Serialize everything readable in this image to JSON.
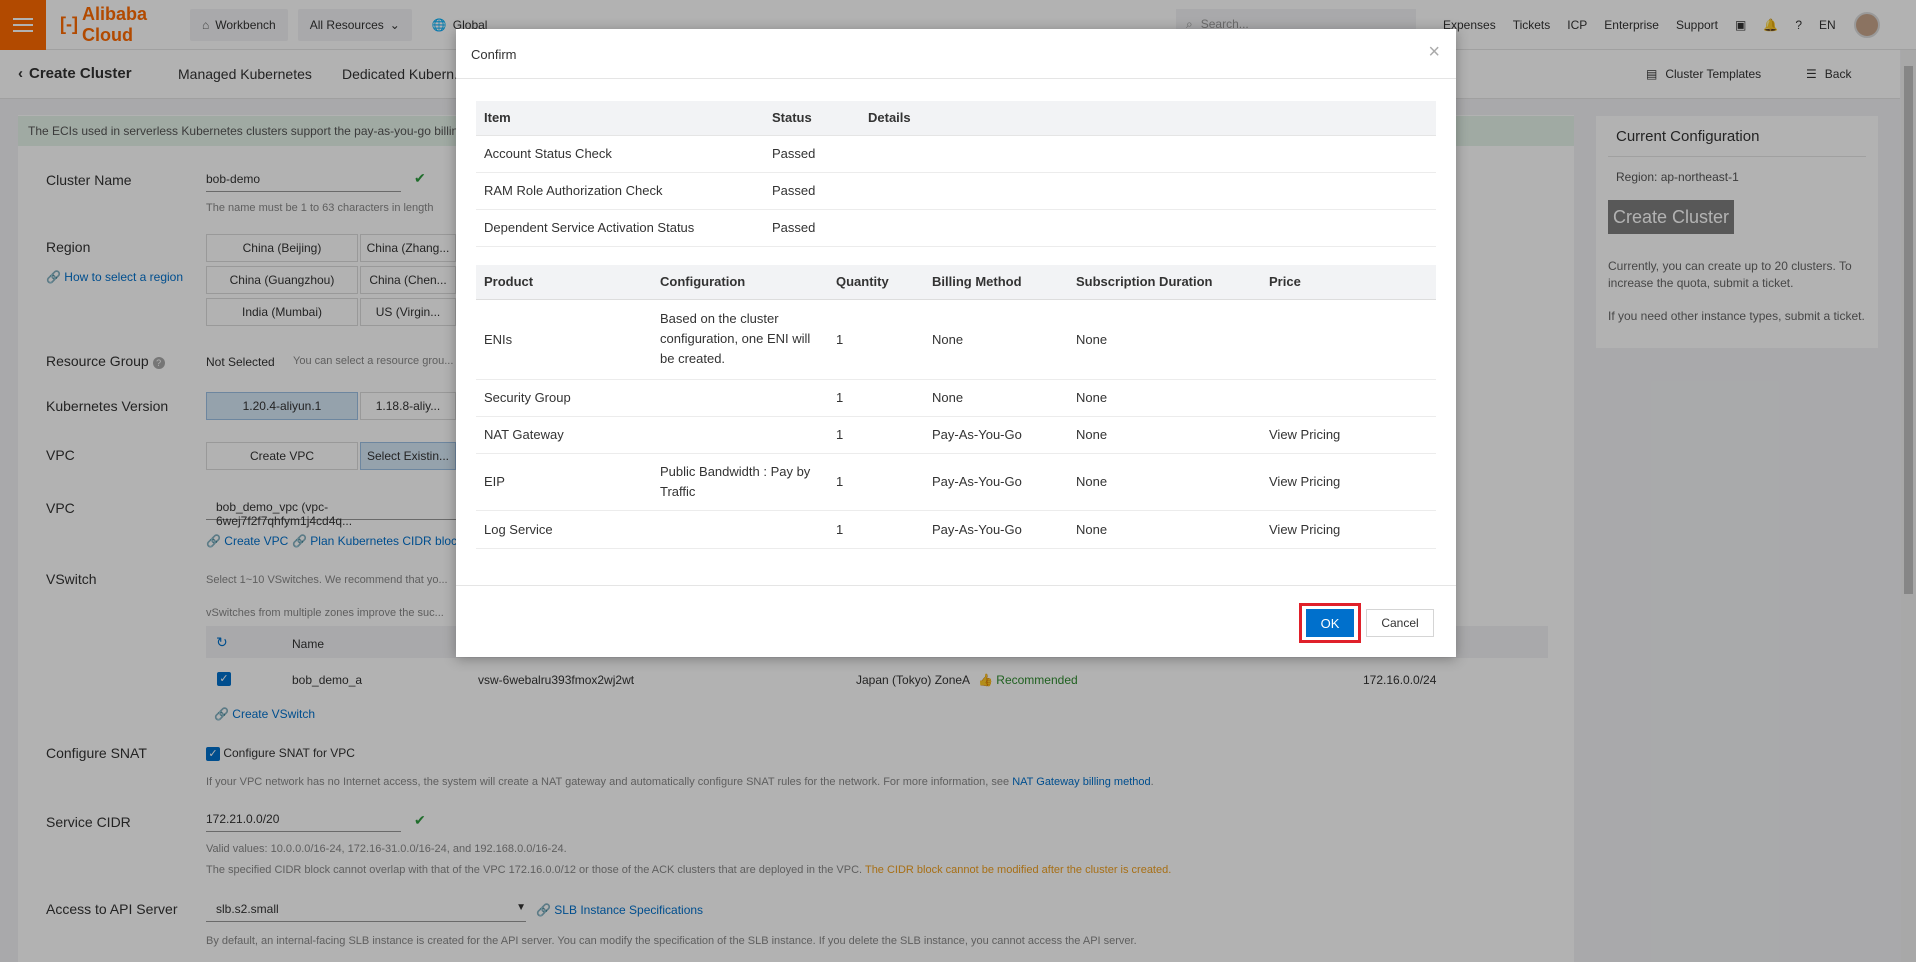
{
  "topbar": {
    "logo": "Alibaba Cloud",
    "workbench": "Workbench",
    "all_resources": "All Resources",
    "global": "Global",
    "search_placeholder": "Search...",
    "nav": [
      "Expenses",
      "Tickets",
      "ICP",
      "Enterprise",
      "Support"
    ],
    "lang": "EN"
  },
  "subbar": {
    "title": "Create Cluster",
    "tabs": [
      "Managed Kubernetes",
      "Dedicated Kubern..."
    ],
    "cluster_templates": "Cluster Templates",
    "back": "Back"
  },
  "notice": "The ECIs used in serverless Kubernetes clusters support the pay-as-you-go billing...",
  "form": {
    "cluster_name_label": "Cluster Name",
    "cluster_name_value": "bob-demo",
    "cluster_name_hint": "The name must be 1 to 63 characters in length",
    "region_label": "Region",
    "region_help": "How to select a region",
    "regions": [
      "China (Beijing)",
      "China (Zhang...",
      "China (Guangzhou)",
      "China (Chen...",
      "India (Mumbai)",
      "US (Virgin..."
    ],
    "resource_group_label": "Resource Group",
    "resource_group_value": "Not Selected",
    "resource_group_hint": "You can select a resource grou...",
    "k8s_version_label": "Kubernetes Version",
    "k8s_versions": [
      "1.20.4-aliyun.1",
      "1.18.8-aliy..."
    ],
    "vpc_label": "VPC",
    "vpc_options": [
      "Create VPC",
      "Select Existin..."
    ],
    "vpc2_label": "VPC",
    "vpc_value": "bob_demo_vpc (vpc-6wej7f2f7qhfym1j4cd4q...",
    "create_vpc_link": "Create VPC",
    "plan_cidr_link": "Plan Kubernetes CIDR blocks",
    "vswitch_label": "VSwitch",
    "vswitch_hint1": "Select 1~10 VSwitches. We recommend that yo...",
    "vswitch_hint2": "vSwitches from multiple zones improve the suc...",
    "vswitch_col_name": "Name",
    "vswitch_row": {
      "name": "bob_demo_a",
      "id": "vsw-6webalru393fmox2wj2wt",
      "zone": "Japan (Tokyo) ZoneA",
      "recommended": "Recommended",
      "cidr": "172.16.0.0/24"
    },
    "create_vswitch": "Create VSwitch",
    "snat_label": "Configure SNAT",
    "snat_checkbox": "Configure SNAT for VPC",
    "snat_hint": "If your VPC network has no Internet access, the system will create a NAT gateway and automatically configure SNAT rules for the network. For more information, see",
    "snat_link": "NAT Gateway billing method",
    "service_cidr_label": "Service CIDR",
    "service_cidr_value": "172.21.0.0/20",
    "service_cidr_hint1": "Valid values: 10.0.0.0/16-24, 172.16-31.0.0/16-24, and 192.168.0.0/16-24.",
    "service_cidr_hint2": "The specified CIDR block cannot overlap with that of the VPC 172.16.0.0/12 or those of the ACK clusters that are deployed in the VPC.",
    "service_cidr_warn": "The CIDR block cannot be modified after the cluster is created.",
    "api_label": "Access to API Server",
    "api_value": "slb.s2.small",
    "api_link": "SLB Instance Specifications",
    "api_hint": "By default, an internal-facing SLB instance is created for the API server. You can modify the specification of the SLB instance. If you delete the SLB instance, you cannot access the API server."
  },
  "right_panel": {
    "title": "Current Configuration",
    "region": "Region: ap-northeast-1",
    "create_button": "Create Cluster",
    "p1": "Currently, you can create up to 20 clusters. To increase the quota, submit a ticket.",
    "p2": "If you need other instance types, submit a ticket."
  },
  "modal": {
    "title": "Confirm",
    "checks_headers": [
      "Item",
      "Status",
      "Details"
    ],
    "checks": [
      {
        "item": "Account Status Check",
        "status": "Passed",
        "details": ""
      },
      {
        "item": "RAM Role Authorization Check",
        "status": "Passed",
        "details": ""
      },
      {
        "item": "Dependent Service Activation Status",
        "status": "Passed",
        "details": ""
      }
    ],
    "products_headers": [
      "Product",
      "Configuration",
      "Quantity",
      "Billing Method",
      "Subscription Duration",
      "Price"
    ],
    "products": [
      {
        "product": "ENIs",
        "configuration": "Based on the cluster configuration, one ENI will be created.",
        "quantity": "1",
        "billing": "None",
        "duration": "None",
        "price": ""
      },
      {
        "product": "Security Group",
        "configuration": "",
        "quantity": "1",
        "billing": "None",
        "duration": "None",
        "price": ""
      },
      {
        "product": "NAT Gateway",
        "configuration": "",
        "quantity": "1",
        "billing": "Pay-As-You-Go",
        "duration": "None",
        "price": "View Pricing"
      },
      {
        "product": "EIP",
        "configuration": "Public Bandwidth : Pay by Traffic",
        "quantity": "1",
        "billing": "Pay-As-You-Go",
        "duration": "None",
        "price": "View Pricing"
      },
      {
        "product": "Log Service",
        "configuration": "",
        "quantity": "1",
        "billing": "Pay-As-You-Go",
        "duration": "None",
        "price": "View Pricing"
      }
    ],
    "ok": "OK",
    "cancel": "Cancel"
  }
}
